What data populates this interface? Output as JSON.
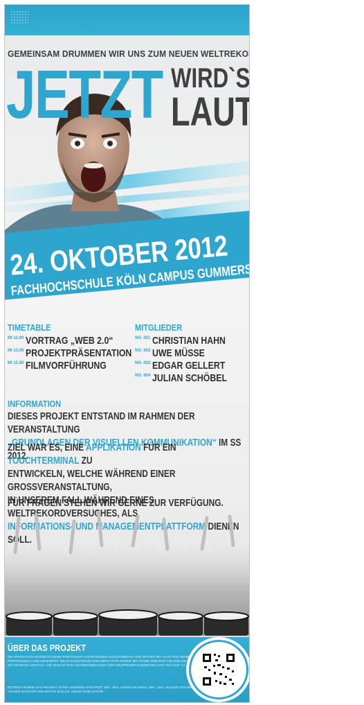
{
  "header": {
    "tagline": "GEMEINSAM DRUMMEN WIR UNS ZUM NEUEN WELTREKORD",
    "headline_big": "JETZT",
    "headline_wirds": "WIRD`S",
    "headline_laut": "LAUT"
  },
  "event": {
    "date": "24. OKTOBER 2012",
    "venue": "FACHHOCHSCHULE KÖLN  CAMPUS GUMMERSBACH"
  },
  "timetable": {
    "title": "TIMETABLE",
    "items": [
      {
        "time": "MI 12.00",
        "label": "VORTRAG „WEB 2.0“"
      },
      {
        "time": "MI 13.00",
        "label": "PROJEKTPRÄSENTATION"
      },
      {
        "time": "MI 15.00",
        "label": "FILMVORFÜHRUNG"
      }
    ]
  },
  "members": {
    "title": "MITGLIEDER",
    "items": [
      {
        "no": "NO. 001",
        "name": "CHRISTIAN HAHN"
      },
      {
        "no": "NO. 002",
        "name": "UWE MÜSSE"
      },
      {
        "no": "NO. 003",
        "name": "EDGAR GELLERT"
      },
      {
        "no": "NO. 004",
        "name": "JULIAN SCHÖBEL"
      }
    ]
  },
  "information": {
    "title": "INFORMATION",
    "p1_a": "DIESES PROJEKT ENTSTAND IM RAHMEN DER VERANSTALTUNG",
    "p1_hl": "„GRUNDLAGEN DER VISUELLEN KOMMUNIKATION“",
    "p1_b": " IM SS 2012.",
    "p2_a": "ZIEL WAR ES, EINE ",
    "p2_hl1": "APPLIKATION",
    "p2_b": " FÜR EIN ",
    "p2_hl2": "TOUCHTERMINAL",
    "p2_c": " ZU",
    "p2_line2": "ENTWICKELN, WELCHE WÄHREND EINER GROSSVERANSTALTUNG,",
    "p2_line3": "IN UNSEREM FALL WÄHREND EINES WELTREKORDVERSUCHES, ALS",
    "p2_hl3": "INFORMATIONS- UND MANAGEMENTPLATTFORM",
    "p2_d": " DIENEN SOLL.",
    "p3": "FÜR FRAGEN STEHEN WIR GERNE ZUR VERFÜGUNG."
  },
  "footer": {
    "title": "ÜBER DAS PROJEKT",
    "text1": "DIE APPLIKATION WURDE IN ADOBE PHOTOSHOP CS5 EXTENDED AUSGEARBEITET UND SPÄTER MIT HILFE VON ADOBE FLASH PROFESSIONAL CS6 UMGESETZT. DIE DAZUGEHÖRIGE DOKUMENTATION WURDE MIT ADOBE INDESIGN CS6 UND DIE PRÄSENTATION MIT KEYNOTE ERSTELLT. DIE GESCHÄTZTE GESAMTARBEITSZEIT DER GRUPPENMITGLIEDER BELÄUFT SICH AUF CA. 300 STUNDEN.",
    "text2": "BETREUT WURDE DAS PROJEKT UNTER ANDEREM VON PROF. DIPL. DES. CHRISTIAN NOSS, DIPL. DES. HOLGER OSTHMANN, B. SC. VOLKER SCHÄFER UND MARTIN BALLAN. VIELEN DANK DAFÜR."
  },
  "colors": {
    "accent": "#2fa6cf",
    "dark_text": "#333333",
    "background": "#eeeeee"
  }
}
